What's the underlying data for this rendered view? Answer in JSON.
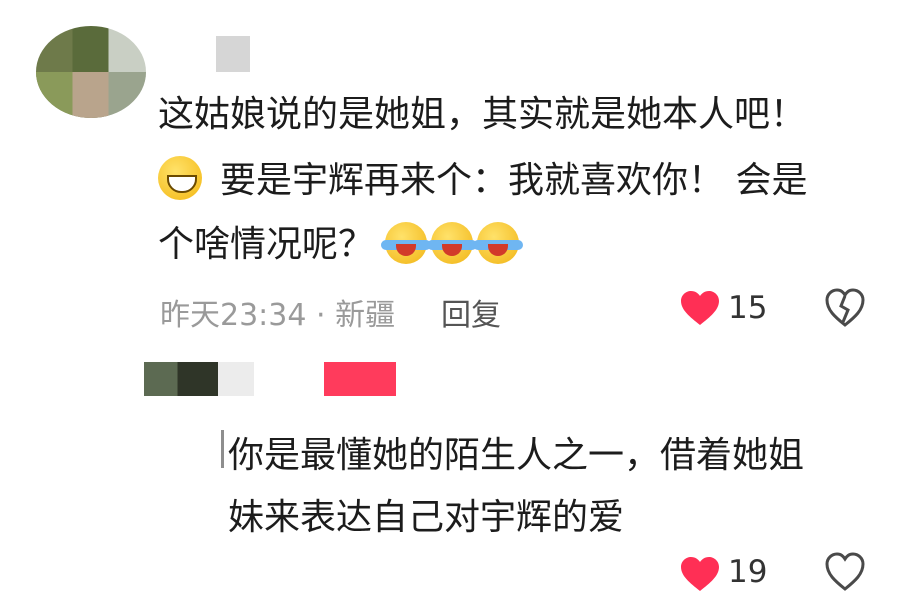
{
  "comments": [
    {
      "text_line1": "这姑娘说的是她姐，其实就是她本人吧！",
      "text_line2": "要是宇辉再来个：我就喜欢你！   会是",
      "text_line3": "个啥情况呢？",
      "emojis": [
        "grinning-face",
        "rolling-on-floor-laughing",
        "rolling-on-floor-laughing",
        "rolling-on-floor-laughing"
      ],
      "time": "昨天23:34",
      "separator": "·",
      "location": "新疆",
      "reply_label": "回复",
      "likes": "15"
    },
    {
      "text_line1": "你是最懂她的陌生人之一，借着她姐",
      "text_line2": "妹来表达自己对宇辉的爱",
      "likes_partial": "19"
    }
  ],
  "colors": {
    "heart": "#ff2f55",
    "meta_text": "#9a9a9a",
    "body_text": "#1c1c1c"
  }
}
